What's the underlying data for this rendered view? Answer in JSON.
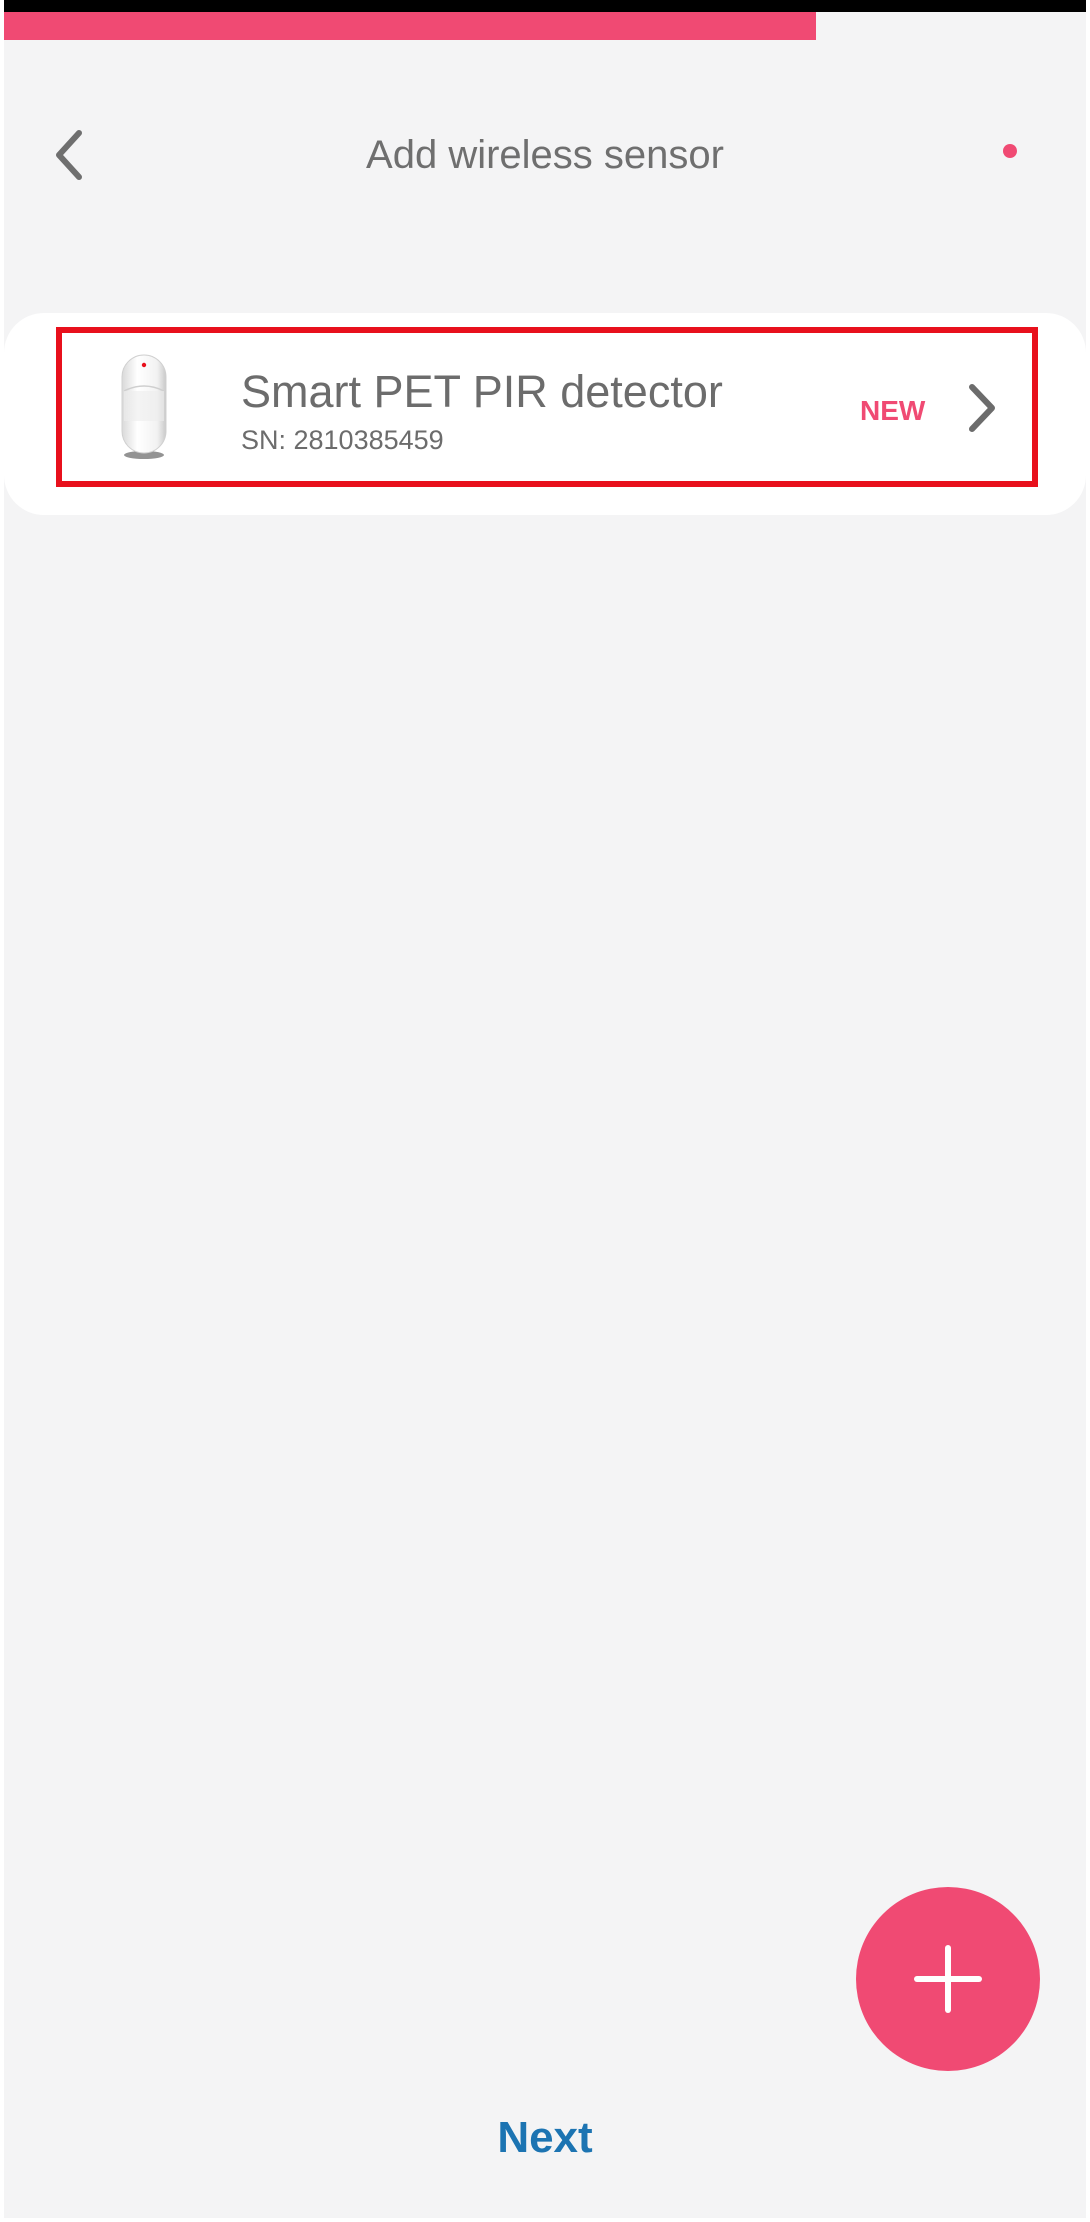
{
  "progress": {
    "fraction": 0.75,
    "color": "#f04a73"
  },
  "header": {
    "title": "Add wireless sensor",
    "back_icon": "chevron-left-icon",
    "status_dot_color": "#f04a73"
  },
  "sensors": [
    {
      "name": "Smart PET PIR detector",
      "serial": "SN: 2810385459",
      "badge": "NEW",
      "icon": "pir-detector-image",
      "chevron_icon": "chevron-right-icon"
    }
  ],
  "fab": {
    "icon": "plus-icon",
    "color": "#f04a73"
  },
  "footer": {
    "next_label": "Next",
    "next_color": "#1c74b2"
  }
}
